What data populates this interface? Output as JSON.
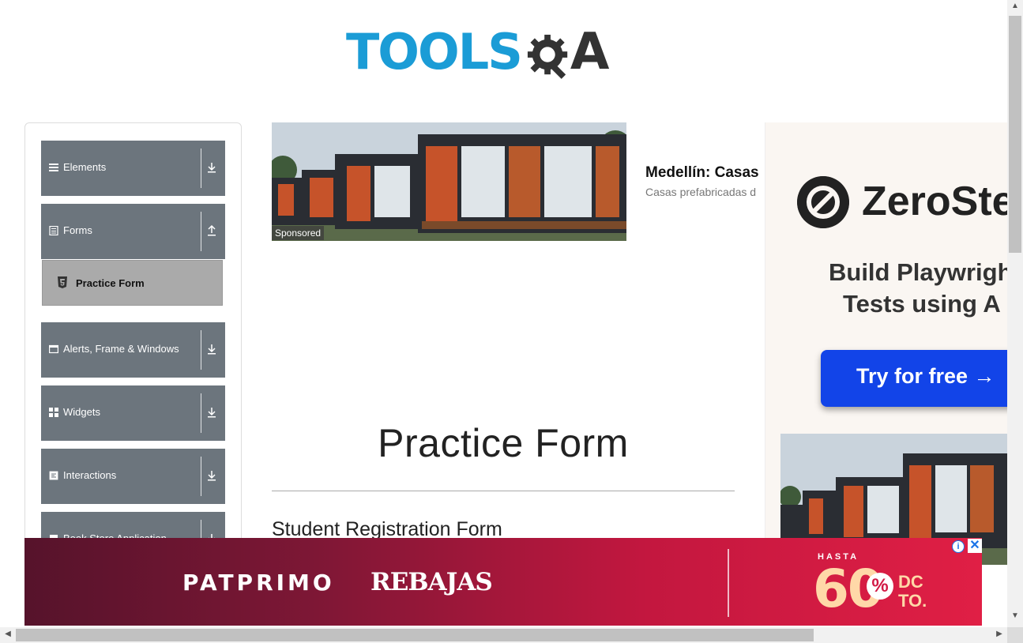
{
  "header": {
    "logo_text": "TOOLS",
    "logo_suffix": "A"
  },
  "sidebar": {
    "groups": [
      {
        "label": "Elements",
        "icon": "list-icon",
        "arrow": "download-arrow-icon"
      },
      {
        "label": "Forms",
        "icon": "form-icon",
        "arrow": "upload-arrow-icon"
      },
      {
        "label": "Alerts, Frame & Windows",
        "icon": "window-icon",
        "arrow": "download-arrow-icon"
      },
      {
        "label": "Widgets",
        "icon": "widgets-icon",
        "arrow": "download-arrow-icon"
      },
      {
        "label": "Interactions",
        "icon": "interactions-icon",
        "arrow": "download-arrow-icon"
      },
      {
        "label": "Book Store Application",
        "icon": "book-icon",
        "arrow": "download-arrow-icon"
      }
    ],
    "active_item": {
      "label": "Practice Form",
      "icon": "html5-icon"
    }
  },
  "sponsored_ad": {
    "tag": "Sponsored",
    "headline": "Medellín: Casas",
    "subline": "Casas prefabricadas d"
  },
  "main": {
    "title": "Practice Form",
    "form_heading": "Student Registration Form"
  },
  "right_ad": {
    "brand": "ZeroSte",
    "line1": "Build Playwrigh",
    "line2": "Tests using A",
    "cta": "Try for free →"
  },
  "bottom_ad": {
    "brand": "PATPRIMO",
    "campaign": "REBAJAS",
    "hasta": "HASTA",
    "discount": "60",
    "percent": "%",
    "dcto": "DC TO."
  },
  "colors": {
    "logo_blue": "#1b9cd6",
    "sidebar_group": "#6c757d",
    "active_item": "#aaaaaa",
    "cta_blue": "#1244e8",
    "banner_red": "#c3173f"
  }
}
